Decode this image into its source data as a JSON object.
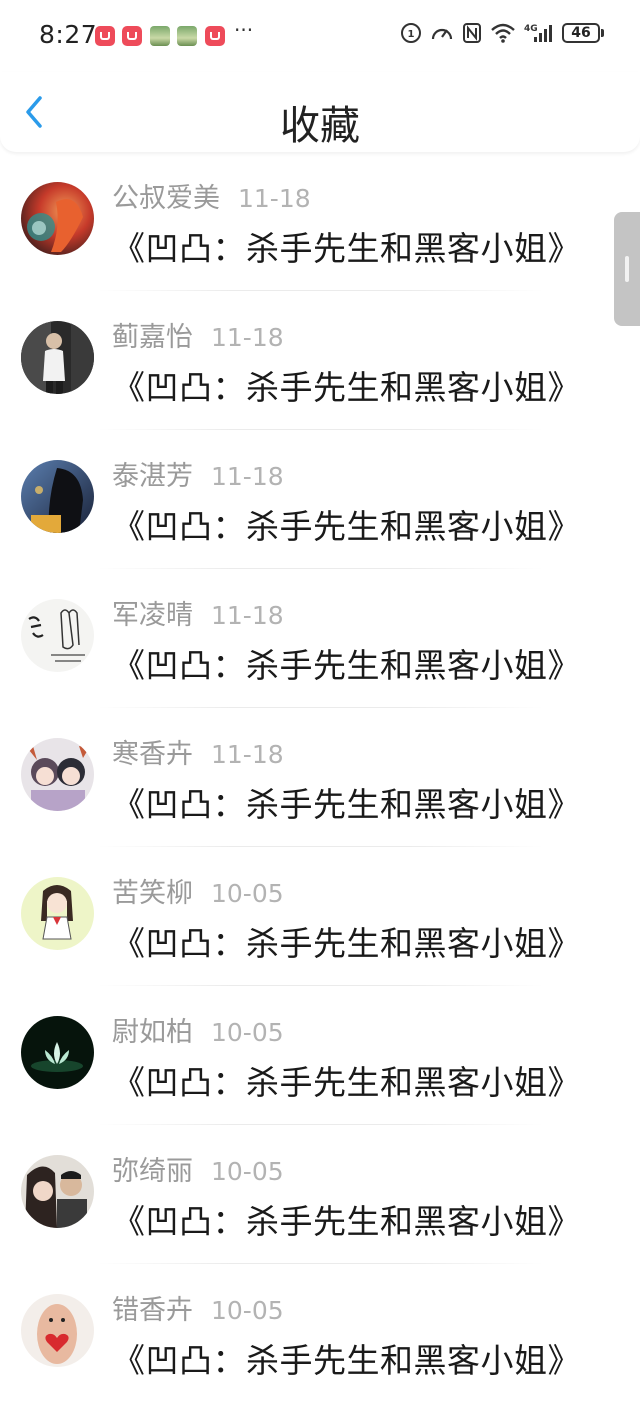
{
  "status_bar": {
    "time": "8:27",
    "overflow": "···",
    "battery": "46",
    "network": "4G",
    "notification_icons": [
      "red-shopping-app-icon",
      "red-shopping-app-icon",
      "green-image-app-icon",
      "green-image-app-icon",
      "red-shopping-app-icon"
    ]
  },
  "header": {
    "title": "收藏",
    "back_icon": "chevron-left-icon",
    "accent_color": "#2b9bea"
  },
  "items": [
    {
      "name": "公叔爱美",
      "date": "11-18",
      "book": "《凹凸：杀手先生和黑客小姐》",
      "avatar": "red-hair-anime-avatar"
    },
    {
      "name": "蓟嘉怡",
      "date": "11-18",
      "book": "《凹凸：杀手先生和黑客小姐》",
      "avatar": "boy-photo-avatar"
    },
    {
      "name": "泰湛芳",
      "date": "11-18",
      "book": "《凹凸：杀手先生和黑客小姐》",
      "avatar": "night-girl-avatar"
    },
    {
      "name": "军凌晴",
      "date": "11-18",
      "book": "《凹凸：杀手先生和黑客小姐》",
      "avatar": "calligraphy-hands-avatar"
    },
    {
      "name": "寒香卉",
      "date": "11-18",
      "book": "《凹凸：杀手先生和黑客小姐》",
      "avatar": "anime-couple-avatar"
    },
    {
      "name": "苦笑柳",
      "date": "10-05",
      "book": "《凹凸：杀手先生和黑客小姐》",
      "avatar": "cartoon-girl-avatar"
    },
    {
      "name": "尉如柏",
      "date": "10-05",
      "book": "《凹凸：杀手先生和黑客小姐》",
      "avatar": "lotus-avatar"
    },
    {
      "name": "弥绮丽",
      "date": "10-05",
      "book": "《凹凸：杀手先生和黑客小姐》",
      "avatar": "couple-photo-avatar"
    },
    {
      "name": "错香卉",
      "date": "10-05",
      "book": "《凹凸：杀手先生和黑客小姐》",
      "avatar": "heart-finger-avatar"
    }
  ]
}
